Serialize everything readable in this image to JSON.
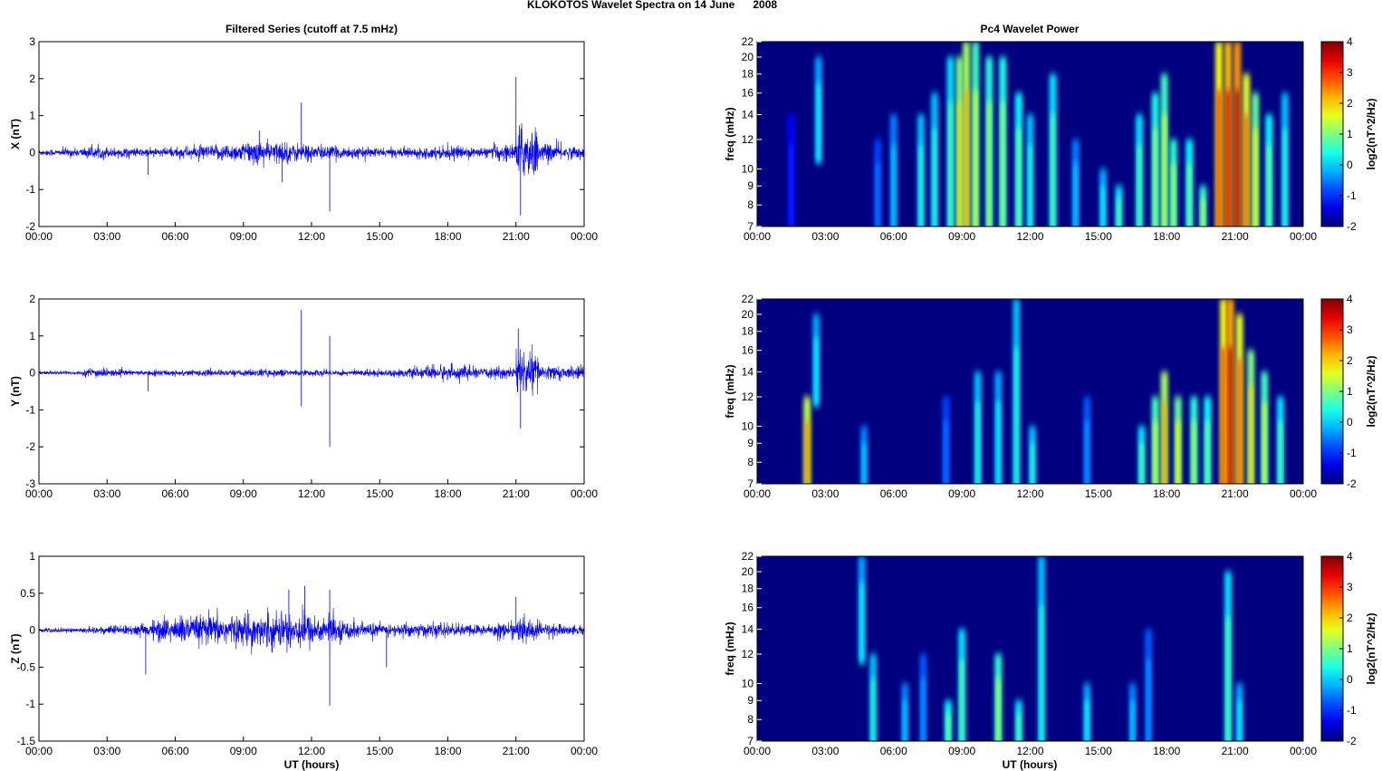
{
  "chart_data": {
    "type": "line+heatmap",
    "title": "KLOKOTOS Wavelet Spectra on 14 June      2008",
    "left_title": "Filtered Series (cutoff at 7.5 mHz)",
    "right_title": "Pc4 Wavelet Power",
    "xlabel": "UT (hours)",
    "x_ticks": [
      "00:00",
      "03:00",
      "06:00",
      "09:00",
      "12:00",
      "15:00",
      "18:00",
      "21:00",
      "00:00"
    ],
    "xlim": [
      0,
      24
    ],
    "line_color": "#0000ff",
    "series": [
      {
        "name": "X (nT)",
        "ylim": [
          -2,
          3
        ],
        "yticks": [
          -2,
          -1,
          0,
          1,
          2,
          3
        ],
        "envelope_per_hour": [
          0.05,
          0.07,
          0.1,
          0.08,
          0.07,
          0.08,
          0.1,
          0.12,
          0.15,
          0.2,
          0.18,
          0.15,
          0.12,
          0.1,
          0.08,
          0.07,
          0.08,
          0.1,
          0.1,
          0.08,
          0.15,
          0.45,
          0.15,
          0.1
        ],
        "spikes": [
          [
            11.55,
            1.35
          ],
          [
            12.8,
            -1.6
          ],
          [
            21.0,
            2.05
          ],
          [
            21.2,
            -1.7
          ],
          [
            9.7,
            0.6
          ],
          [
            4.8,
            -0.6
          ],
          [
            10.7,
            -0.8
          ]
        ]
      },
      {
        "name": "Y (nT)",
        "ylim": [
          -3,
          2
        ],
        "yticks": [
          -3,
          -2,
          -1,
          0,
          1,
          2
        ],
        "envelope_per_hour": [
          0.03,
          0.03,
          0.08,
          0.05,
          0.04,
          0.05,
          0.05,
          0.05,
          0.05,
          0.06,
          0.06,
          0.05,
          0.05,
          0.05,
          0.06,
          0.06,
          0.08,
          0.12,
          0.12,
          0.08,
          0.1,
          0.35,
          0.12,
          0.1
        ],
        "spikes": [
          [
            11.55,
            1.7
          ],
          [
            11.55,
            -0.9
          ],
          [
            12.8,
            1.0
          ],
          [
            12.8,
            -2.0
          ],
          [
            21.1,
            1.2
          ],
          [
            21.2,
            -1.5
          ],
          [
            4.8,
            -0.5
          ]
        ]
      },
      {
        "name": "Z (nT)",
        "ylim": [
          -1.5,
          1
        ],
        "yticks": [
          -1.5,
          -1,
          -0.5,
          0,
          0.5,
          1
        ],
        "envelope_per_hour": [
          0.02,
          0.02,
          0.03,
          0.04,
          0.05,
          0.1,
          0.12,
          0.12,
          0.12,
          0.14,
          0.15,
          0.15,
          0.12,
          0.08,
          0.06,
          0.05,
          0.06,
          0.06,
          0.05,
          0.05,
          0.07,
          0.1,
          0.06,
          0.04
        ],
        "spikes": [
          [
            12.8,
            -1.02
          ],
          [
            12.8,
            0.55
          ],
          [
            11.0,
            0.55
          ],
          [
            11.7,
            0.6
          ],
          [
            4.7,
            -0.6
          ],
          [
            21.0,
            0.45
          ],
          [
            15.3,
            -0.5
          ]
        ]
      }
    ],
    "wavelet": {
      "ylabel": "freq (mHz)",
      "yticks": [
        7,
        8,
        9,
        10,
        12,
        14,
        16,
        18,
        20,
        22
      ],
      "ylim": [
        7,
        22
      ],
      "colorbar_label": "log2(nT^2/Hz)",
      "clim": [
        -2,
        4
      ],
      "colorbar_ticks": [
        -2,
        -1,
        0,
        1,
        2,
        3,
        4
      ],
      "events_t_flo_fhi_power": [
        [
          [
            1.5,
            7,
            14,
            -1
          ],
          [
            2.7,
            11,
            20,
            0.3
          ],
          [
            5.3,
            7,
            12,
            -0.5
          ],
          [
            6.0,
            7,
            14,
            0
          ],
          [
            7.2,
            7,
            14,
            0.5
          ],
          [
            7.8,
            7,
            16,
            0.5
          ],
          [
            8.5,
            7,
            20,
            0.8
          ],
          [
            8.9,
            7,
            20,
            2.0
          ],
          [
            9.2,
            7,
            22,
            2.3
          ],
          [
            9.6,
            7,
            22,
            1.5
          ],
          [
            10.2,
            7,
            20,
            1.3
          ],
          [
            10.8,
            7,
            20,
            1.2
          ],
          [
            11.5,
            7,
            16,
            1.0
          ],
          [
            12.0,
            7,
            14,
            0.5
          ],
          [
            13.0,
            7,
            18,
            0.8
          ],
          [
            14.0,
            7,
            12,
            0
          ],
          [
            15.2,
            7,
            10,
            0.3
          ],
          [
            15.9,
            7,
            9,
            0.8
          ],
          [
            16.8,
            7,
            14,
            0.8
          ],
          [
            17.5,
            7,
            16,
            1.2
          ],
          [
            17.9,
            7,
            18,
            1.5
          ],
          [
            18.3,
            7,
            12,
            1.3
          ],
          [
            19.0,
            7,
            12,
            1.0
          ],
          [
            19.6,
            7,
            9,
            1.3
          ],
          [
            20.3,
            7,
            22,
            3.0
          ],
          [
            20.7,
            7,
            22,
            3.5
          ],
          [
            21.1,
            7,
            22,
            3.8
          ],
          [
            21.5,
            7,
            18,
            2.8
          ],
          [
            21.9,
            7,
            16,
            1.8
          ],
          [
            22.5,
            7,
            14,
            1.0
          ],
          [
            23.2,
            7,
            16,
            0.5
          ]
        ],
        [
          [
            2.2,
            7,
            12,
            2.5
          ],
          [
            2.6,
            12,
            20,
            0.3
          ],
          [
            4.7,
            7,
            10,
            0
          ],
          [
            8.3,
            7,
            12,
            -0.5
          ],
          [
            9.7,
            7,
            14,
            0.5
          ],
          [
            10.6,
            7,
            14,
            0.3
          ],
          [
            11.4,
            7,
            22,
            0.5
          ],
          [
            12.1,
            7,
            10,
            0.5
          ],
          [
            14.5,
            7,
            12,
            -0.3
          ],
          [
            16.9,
            7,
            10,
            0.8
          ],
          [
            17.5,
            7,
            12,
            1.5
          ],
          [
            17.9,
            7,
            14,
            2.3
          ],
          [
            18.5,
            7,
            12,
            1.8
          ],
          [
            19.2,
            7,
            12,
            1.3
          ],
          [
            19.8,
            7,
            12,
            1.0
          ],
          [
            20.5,
            7,
            22,
            3.0
          ],
          [
            20.8,
            7,
            22,
            3.7
          ],
          [
            21.2,
            7,
            20,
            2.8
          ],
          [
            21.7,
            7,
            16,
            2.0
          ],
          [
            22.3,
            7,
            14,
            1.5
          ],
          [
            23.0,
            7,
            12,
            0.8
          ]
        ],
        [
          [
            4.6,
            12,
            22,
            0.3
          ],
          [
            5.1,
            7,
            12,
            0.5
          ],
          [
            6.5,
            7,
            10,
            0
          ],
          [
            7.3,
            7,
            12,
            -0.3
          ],
          [
            8.4,
            7,
            9,
            1.0
          ],
          [
            9.0,
            7,
            14,
            0.8
          ],
          [
            10.6,
            7,
            12,
            1.3
          ],
          [
            11.5,
            7,
            9,
            0.8
          ],
          [
            12.5,
            7,
            22,
            0.5
          ],
          [
            14.5,
            7,
            10,
            0.3
          ],
          [
            16.5,
            7,
            10,
            0
          ],
          [
            17.2,
            7,
            14,
            -0.3
          ],
          [
            20.7,
            7,
            20,
            0.8
          ],
          [
            21.2,
            7,
            10,
            0.3
          ]
        ]
      ]
    }
  }
}
